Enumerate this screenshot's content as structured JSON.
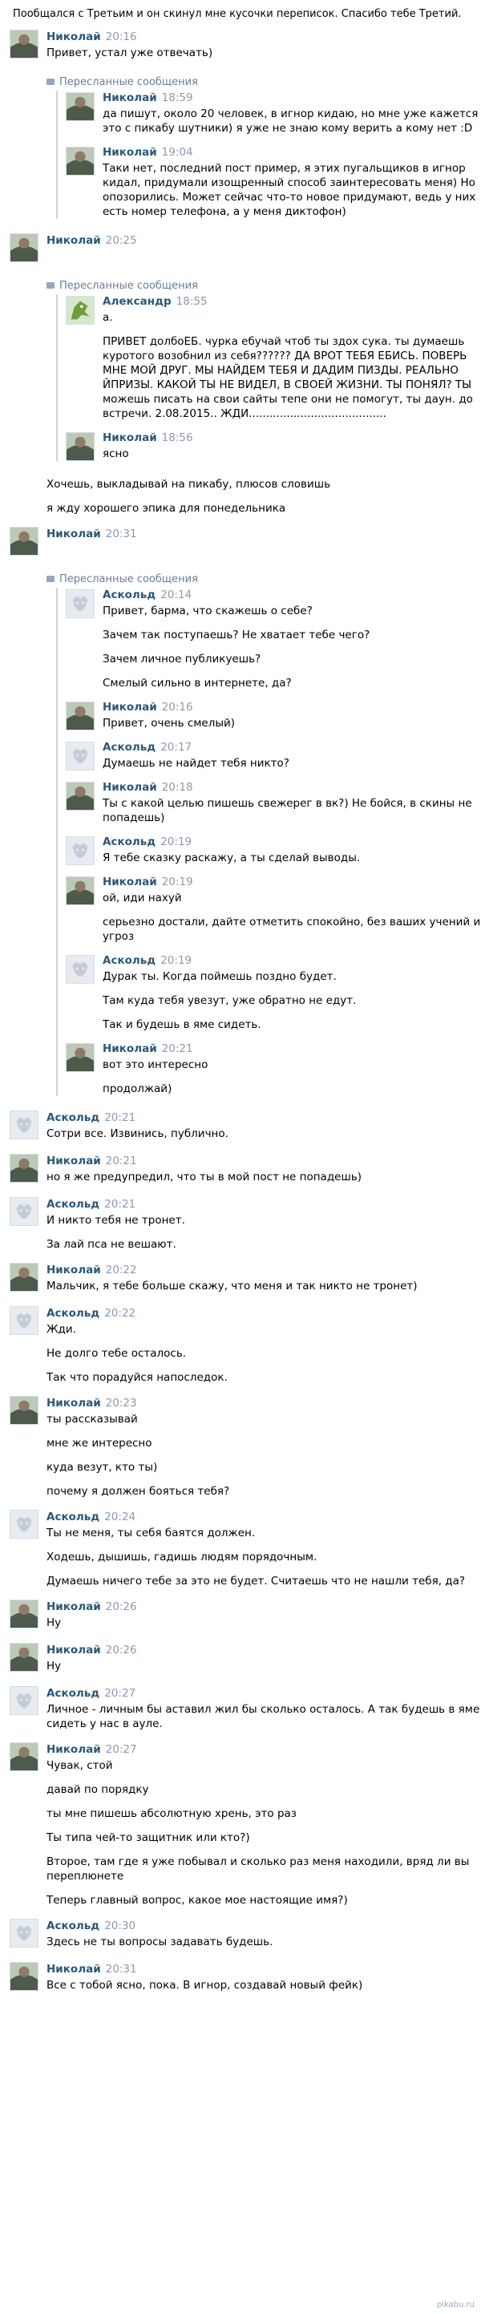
{
  "intro": "Пообщался с Третьим и он скинул мне кусочки переписок. Спасибо тебе Третий.",
  "labels": {
    "forwarded": "Пересланные сообщения"
  },
  "messages": [
    {
      "id": "m1",
      "name": "Николай",
      "time": "20:16",
      "texts": [
        "Привет, устал уже отвечать)"
      ]
    },
    {
      "id": "fwd1",
      "forwarded": [
        {
          "name": "Николай",
          "time": "18:59",
          "texts": [
            "да пишут, около 20 человек, в игнор кидаю, но мне уже кажется это с пикабу шутники) я уже не знаю кому верить а кому нет :D"
          ]
        },
        {
          "name": "Николай",
          "time": "19:04",
          "texts": [
            "Таки нет, последний пост пример, я этих пугальщиков в игнор кидал, придумали изощренный способ заинтересовать меня) Но опозорились. Может сейчас что-то новое придумают, ведь у них есть номер телефона, а у меня диктофон)"
          ]
        }
      ]
    },
    {
      "id": "m2",
      "name": "Николай",
      "time": "20:25"
    },
    {
      "id": "fwd2",
      "forwarded": [
        {
          "name": "Александр",
          "time": "18:55",
          "texts": [
            "а.",
            "ПРИВЕТ долбоЕБ. чурка ебучай чтоб ты здох сука. ты думаешь куротого возобнил из себя?????? ДА ВРОТ ТЕБЯ ЕБИСЬ. ПОВЕРЬ МНЕ МОЙ ДРУГ. МЫ НАЙДЕМ ТЕБЯ И ДАДИМ ПИЗДЫ. РЕАЛЬНО ЙПРИЗЫ. КАКОЙ ТЫ НЕ ВИДЕЛ, В СВОЕЙ ЖИЗНИ. ТЫ ПОНЯЛ? ТЫ можешь писать на свои сайты тепе они не помогут, ты даун. до встречи. 2.08.2015.. ЖДИ........................................"
          ]
        },
        {
          "name": "Николай",
          "time": "18:56",
          "texts": [
            "ясно"
          ]
        }
      ]
    },
    {
      "id": "m3",
      "texts": [
        "Хочешь, выкладывай на пикабу, плюсов словишь",
        "я жду хорошего эпика для понедельника"
      ]
    },
    {
      "id": "m4",
      "name": "Николай",
      "time": "20:31"
    },
    {
      "id": "fwd3",
      "forwarded": [
        {
          "name": "Аскольд",
          "time": "20:14",
          "texts": [
            "Привет, барма, что скажешь о себе?",
            "Зачем так поступаешь? Не хватает тебе чего?",
            "Зачем личное публикуешь?",
            "Смелый сильно в интернете, да?"
          ]
        },
        {
          "name": "Николай",
          "time": "20:16",
          "texts": [
            "Привет, очень смелый)"
          ]
        },
        {
          "name": "Аскольд",
          "time": "20:17",
          "texts": [
            "Думаешь не найдет тебя никто?"
          ]
        },
        {
          "name": "Николай",
          "time": "20:18",
          "texts": [
            "Ты с какой целью пишешь свежерег в вк?) Не бойся, в скины не попадешь)"
          ]
        },
        {
          "name": "Аскольд",
          "time": "20:19",
          "texts": [
            "Я тебе сказку раскажу, а ты сделай выводы."
          ]
        },
        {
          "name": "Николай",
          "time": "20:19",
          "texts": [
            "ой, иди нахуй",
            "серьезно достали, дайте отметить спокойно, без ваших учений и угроз"
          ]
        },
        {
          "name": "Аскольд",
          "time": "20:19",
          "texts": [
            "Дурак ты. Когда поймешь поздно будет.",
            "Там куда тебя увезут, уже обратно не едут.",
            "Так и будешь в яме сидеть."
          ]
        },
        {
          "name": "Николай",
          "time": "20:21",
          "texts": [
            "вот это интересно",
            "продолжай)"
          ]
        }
      ]
    },
    {
      "id": "m5",
      "name": "Аскольд",
      "time": "20:21",
      "texts": [
        "Сотри все. Извинись, публично."
      ]
    },
    {
      "id": "m6",
      "name": "Николай",
      "time": "20:21",
      "texts": [
        "но я же предупредил, что ты в мой пост не попадешь)"
      ]
    },
    {
      "id": "m7",
      "name": "Аскольд",
      "time": "20:21",
      "texts": [
        "И никто тебя не тронет.",
        "За лай пса не вешают."
      ]
    },
    {
      "id": "m8",
      "name": "Николай",
      "time": "20:22",
      "texts": [
        "Мальчик, я тебе больше скажу, что меня и так никто не тронет)"
      ]
    },
    {
      "id": "m9",
      "name": "Аскольд",
      "time": "20:22",
      "texts": [
        "Жди.",
        "Не долго тебе осталось.",
        "Так что порадуйся напоследок."
      ]
    },
    {
      "id": "m10",
      "name": "Николай",
      "time": "20:23",
      "texts": [
        "ты рассказывай",
        "мне же интересно",
        "куда везут, кто ты)",
        "почему я должен бояться тебя?"
      ]
    },
    {
      "id": "m11",
      "name": "Аскольд",
      "time": "20:24",
      "texts": [
        "Ты не меня, ты себя баятся должен.",
        "Ходешь, дышишь, гадишь людям порядочным.",
        "Думаешь ничего тебе за это не будет. Считаешь что не нашли тебя, да?"
      ]
    },
    {
      "id": "m12",
      "name": "Николай",
      "time": "20:26",
      "texts": [
        "Ну"
      ]
    },
    {
      "id": "m13",
      "name": "Николай",
      "time": "20:26",
      "texts": [
        "Ну"
      ]
    },
    {
      "id": "m14",
      "name": "Аскольд",
      "time": "20:27",
      "texts": [
        "Личное - личным бы аставил жил бы сколько осталось. А так будешь в яме сидеть у нас в ауле."
      ]
    },
    {
      "id": "m15",
      "name": "Николай",
      "time": "20:27",
      "texts": [
        "Чувак, стой",
        "давай по порядку",
        "ты мне пишешь абсолютную хрень, это раз",
        "Ты типа чей-то защитник или кто?)",
        "Второе, там где я уже побывал и сколько раз меня находили, вряд ли вы переплюнете",
        "Теперь главный вопрос, какое мое настоящие имя?)"
      ]
    },
    {
      "id": "m16",
      "name": "Аскольд",
      "time": "20:30",
      "texts": [
        "Здесь не ты вопросы задавать будешь."
      ]
    },
    {
      "id": "m17",
      "name": "Николай",
      "time": "20:31",
      "texts": [
        "Все с тобой ясно, пока. В игнор, создавай новый фейк)"
      ]
    }
  ],
  "watermark": "pikabu.ru"
}
